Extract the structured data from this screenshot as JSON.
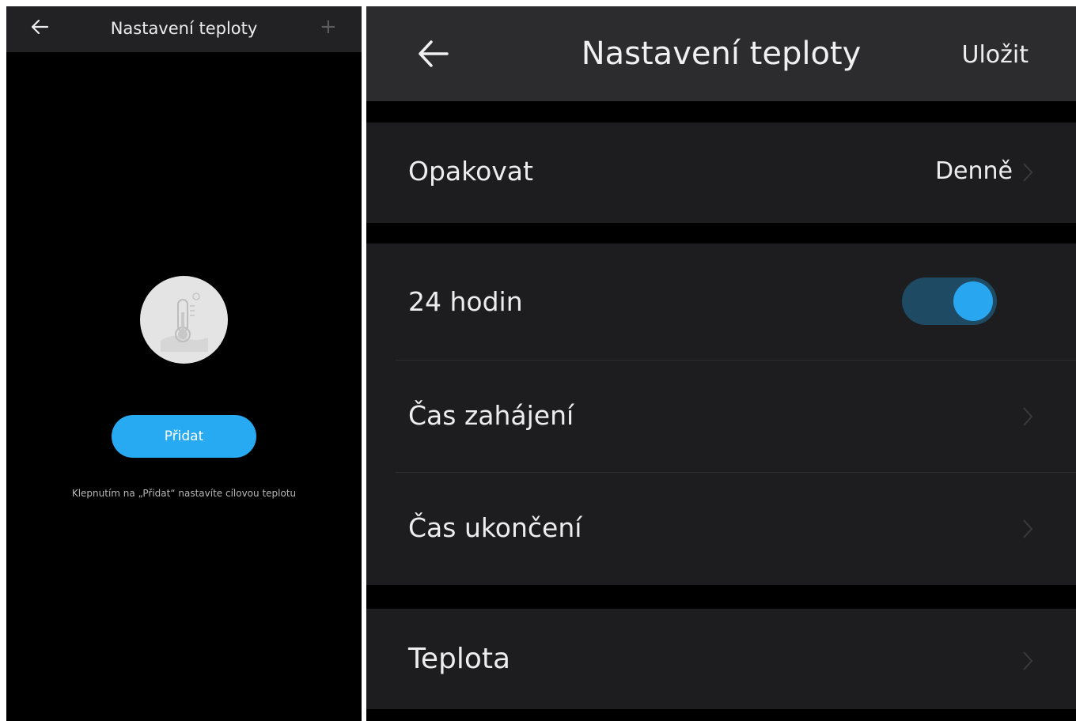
{
  "left_screen": {
    "header": {
      "title": "Nastavení teploty",
      "back_icon": "back-arrow-icon",
      "add_icon": "plus-icon"
    },
    "empty_state": {
      "icon": "thermometer-icon",
      "add_button_label": "Přidat",
      "hint": "Klepnutím na „Přidat“ nastavíte cílovou teplotu"
    }
  },
  "right_screen": {
    "header": {
      "title": "Nastavení teploty",
      "save_label": "Uložit",
      "back_icon": "back-arrow-icon"
    },
    "repeat": {
      "label": "Opakovat",
      "value": "Denně"
    },
    "hours24": {
      "label": "24 hodin",
      "enabled": true
    },
    "start_time": {
      "label": "Čas zahájení"
    },
    "end_time": {
      "label": "Čas ukončení"
    },
    "temperature": {
      "label": "Teplota"
    }
  },
  "colors": {
    "accent": "#27aaf2",
    "background": "#000000",
    "header": "#2c2c2e",
    "row": "#1d1d1f",
    "toggle_track": "#1e4b63"
  }
}
